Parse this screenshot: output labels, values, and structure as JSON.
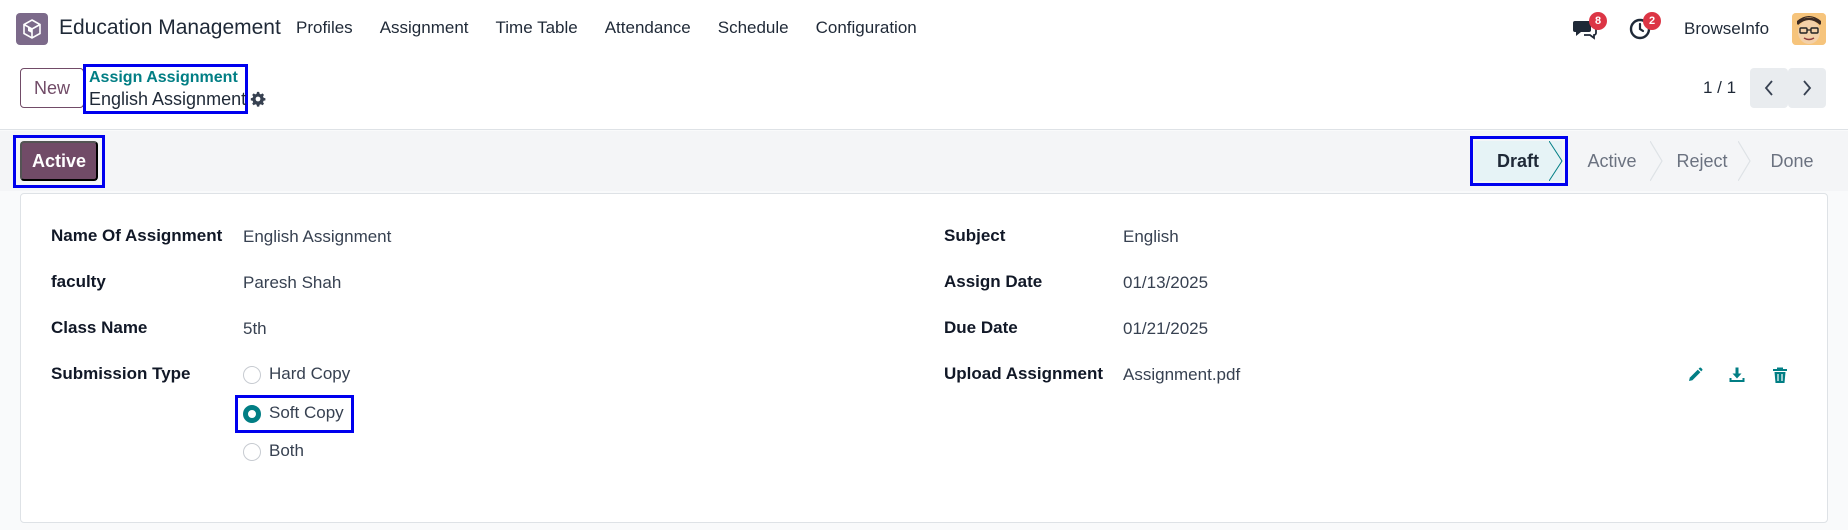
{
  "navbar": {
    "app_title": "Education Management",
    "menu": [
      "Profiles",
      "Assignment",
      "Time Table",
      "Attendance",
      "Schedule",
      "Configuration"
    ],
    "messages_count": "8",
    "activities_count": "2",
    "company": "BrowseInfo"
  },
  "control": {
    "new_label": "New",
    "breadcrumb_parent": "Assign Assignment",
    "breadcrumb_current": "English Assignment",
    "pager": "1 / 1"
  },
  "statusbar": {
    "action_label": "Active",
    "stages": [
      "Draft",
      "Active",
      "Reject",
      "Done"
    ],
    "current_stage": "Draft"
  },
  "form": {
    "left": {
      "name_label": "Name Of Assignment",
      "name_value": "English Assignment",
      "faculty_label": "faculty",
      "faculty_value": "Paresh Shah",
      "class_label": "Class Name",
      "class_value": "5th",
      "submission_label": "Submission Type",
      "submission_options": [
        "Hard Copy",
        "Soft Copy",
        "Both"
      ],
      "submission_selected": "Soft Copy"
    },
    "right": {
      "subject_label": "Subject",
      "subject_value": "English",
      "assign_date_label": "Assign Date",
      "assign_date_value": "01/13/2025",
      "due_date_label": "Due Date",
      "due_date_value": "01/21/2025",
      "upload_label": "Upload Assignment",
      "upload_value": "Assignment.pdf"
    }
  },
  "icons": {
    "edit": "pencil-icon",
    "download": "download-icon",
    "delete": "trash-icon"
  },
  "colors": {
    "brand": "#714b67",
    "accent": "#017e84",
    "badge": "#dc3545",
    "highlight": "#0000ee"
  }
}
